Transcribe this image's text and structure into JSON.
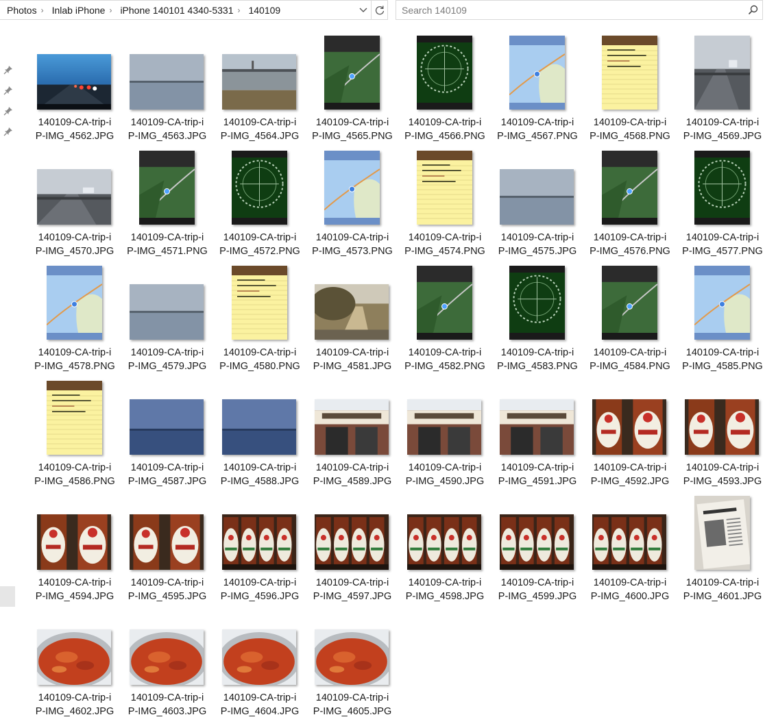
{
  "breadcrumb": [
    "Photos",
    "Inlab iPhone",
    "iPhone 140101 4340-5331",
    "140109"
  ],
  "search": {
    "placeholder": "Search 140109"
  },
  "files": [
    {
      "l1": "140109-CA-trip-i",
      "l2": "P-IMG_4562.JPG",
      "kind": "road"
    },
    {
      "l1": "140109-CA-trip-i",
      "l2": "P-IMG_4563.JPG",
      "kind": "bay"
    },
    {
      "l1": "140109-CA-trip-i",
      "l2": "P-IMG_4564.JPG",
      "kind": "shore"
    },
    {
      "l1": "140109-CA-trip-i",
      "l2": "P-IMG_4565.PNG",
      "kind": "map-sat"
    },
    {
      "l1": "140109-CA-trip-i",
      "l2": "P-IMG_4566.PNG",
      "kind": "compass"
    },
    {
      "l1": "140109-CA-trip-i",
      "l2": "P-IMG_4567.PNG",
      "kind": "map"
    },
    {
      "l1": "140109-CA-trip-i",
      "l2": "P-IMG_4568.PNG",
      "kind": "notes"
    },
    {
      "l1": "140109-CA-trip-i",
      "l2": "P-IMG_4569.JPG",
      "kind": "bridge-tall"
    },
    {
      "l1": "140109-CA-trip-i",
      "l2": "P-IMG_4570.JPG",
      "kind": "bridge"
    },
    {
      "l1": "140109-CA-trip-i",
      "l2": "P-IMG_4571.PNG",
      "kind": "map-sat"
    },
    {
      "l1": "140109-CA-trip-i",
      "l2": "P-IMG_4572.PNG",
      "kind": "compass"
    },
    {
      "l1": "140109-CA-trip-i",
      "l2": "P-IMG_4573.PNG",
      "kind": "map"
    },
    {
      "l1": "140109-CA-trip-i",
      "l2": "P-IMG_4574.PNG",
      "kind": "notes"
    },
    {
      "l1": "140109-CA-trip-i",
      "l2": "P-IMG_4575.JPG",
      "kind": "bay"
    },
    {
      "l1": "140109-CA-trip-i",
      "l2": "P-IMG_4576.PNG",
      "kind": "map-sat"
    },
    {
      "l1": "140109-CA-trip-i",
      "l2": "P-IMG_4577.PNG",
      "kind": "compass"
    },
    {
      "l1": "140109-CA-trip-i",
      "l2": "P-IMG_4578.PNG",
      "kind": "map"
    },
    {
      "l1": "140109-CA-trip-i",
      "l2": "P-IMG_4579.JPG",
      "kind": "bay"
    },
    {
      "l1": "140109-CA-trip-i",
      "l2": "P-IMG_4580.PNG",
      "kind": "notes"
    },
    {
      "l1": "140109-CA-trip-i",
      "l2": "P-IMG_4581.JPG",
      "kind": "brush"
    },
    {
      "l1": "140109-CA-trip-i",
      "l2": "P-IMG_4582.PNG",
      "kind": "map-sat"
    },
    {
      "l1": "140109-CA-trip-i",
      "l2": "P-IMG_4583.PNG",
      "kind": "compass"
    },
    {
      "l1": "140109-CA-trip-i",
      "l2": "P-IMG_4584.PNG",
      "kind": "map-sat"
    },
    {
      "l1": "140109-CA-trip-i",
      "l2": "P-IMG_4585.PNG",
      "kind": "map"
    },
    {
      "l1": "140109-CA-trip-i",
      "l2": "P-IMG_4586.PNG",
      "kind": "notes"
    },
    {
      "l1": "140109-CA-trip-i",
      "l2": "P-IMG_4587.JPG",
      "kind": "bay-blue"
    },
    {
      "l1": "140109-CA-trip-i",
      "l2": "P-IMG_4588.JPG",
      "kind": "bay-blue"
    },
    {
      "l1": "140109-CA-trip-i",
      "l2": "P-IMG_4589.JPG",
      "kind": "store"
    },
    {
      "l1": "140109-CA-trip-i",
      "l2": "P-IMG_4590.JPG",
      "kind": "store"
    },
    {
      "l1": "140109-CA-trip-i",
      "l2": "P-IMG_4591.JPG",
      "kind": "store"
    },
    {
      "l1": "140109-CA-trip-i",
      "l2": "P-IMG_4592.JPG",
      "kind": "tabasco"
    },
    {
      "l1": "140109-CA-trip-i",
      "l2": "P-IMG_4593.JPG",
      "kind": "tabasco"
    },
    {
      "l1": "140109-CA-trip-i",
      "l2": "P-IMG_4594.JPG",
      "kind": "tabasco"
    },
    {
      "l1": "140109-CA-trip-i",
      "l2": "P-IMG_4595.JPG",
      "kind": "tabasco"
    },
    {
      "l1": "140109-CA-trip-i",
      "l2": "P-IMG_4596.JPG",
      "kind": "bottles"
    },
    {
      "l1": "140109-CA-trip-i",
      "l2": "P-IMG_4597.JPG",
      "kind": "bottles"
    },
    {
      "l1": "140109-CA-trip-i",
      "l2": "P-IMG_4598.JPG",
      "kind": "bottles"
    },
    {
      "l1": "140109-CA-trip-i",
      "l2": "P-IMG_4599.JPG",
      "kind": "bottles"
    },
    {
      "l1": "140109-CA-trip-i",
      "l2": "P-IMG_4600.JPG",
      "kind": "bottles"
    },
    {
      "l1": "140109-CA-trip-i",
      "l2": "P-IMG_4601.JPG",
      "kind": "newspaper"
    },
    {
      "l1": "140109-CA-trip-i",
      "l2": "P-IMG_4602.JPG",
      "kind": "stew"
    },
    {
      "l1": "140109-CA-trip-i",
      "l2": "P-IMG_4603.JPG",
      "kind": "stew"
    },
    {
      "l1": "140109-CA-trip-i",
      "l2": "P-IMG_4604.JPG",
      "kind": "stew"
    },
    {
      "l1": "140109-CA-trip-i",
      "l2": "P-IMG_4605.JPG",
      "kind": "stew"
    }
  ]
}
